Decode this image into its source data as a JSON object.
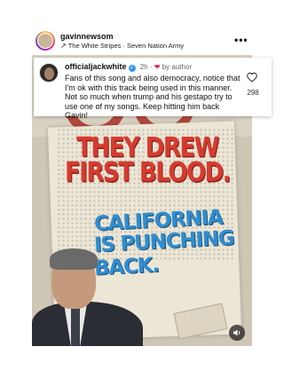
{
  "post": {
    "username": "gavinnewsom",
    "audio_track": "The White Stripes · Seven Nation Army",
    "more_label": "•••"
  },
  "poster": {
    "headline_red": [
      "THEY DREW",
      "FIRST BLOOD."
    ],
    "headline_blue": [
      "CALIFORNIA",
      "IS PUNCHING",
      "BACK."
    ]
  },
  "comment": {
    "username": "officialjackwhite",
    "time": "2h",
    "liked_by": "by author",
    "text": "Fans of this song and also democracy, notice that I'm ok with this track being used in this manner. Not so much when trump and his gestapo try to use one of my songs.  Keep hitting him back Gavin!",
    "like_count": "298"
  },
  "colors": {
    "headline_red": "#d63b2f",
    "headline_blue": "#2f8dd0",
    "verified_badge": "#3897f0",
    "author_heart": "#e0245e"
  },
  "icons": {
    "audio": "arrow-trending-icon",
    "more": "more-options-icon",
    "like": "heart-outline-icon",
    "author_like": "heart-filled-icon",
    "verified": "verified-badge-icon",
    "mute": "speaker-icon"
  }
}
